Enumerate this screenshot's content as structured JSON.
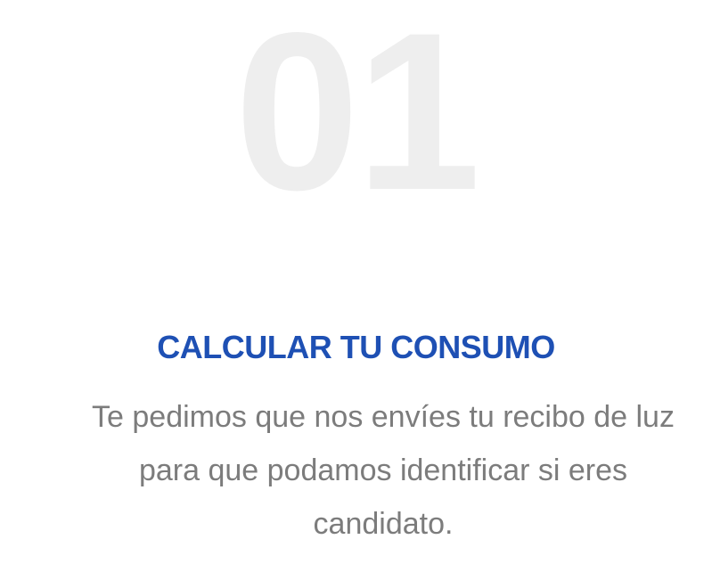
{
  "step": {
    "number": "01",
    "title": "CALCULAR TU CONSUMO",
    "description": "Te pedimos que nos envíes tu recibo de luz para que podamos identificar si eres candidato."
  },
  "colors": {
    "number": "#eeeeee",
    "title": "#1e50b4",
    "description": "#7c7c7c",
    "background": "#ffffff"
  }
}
